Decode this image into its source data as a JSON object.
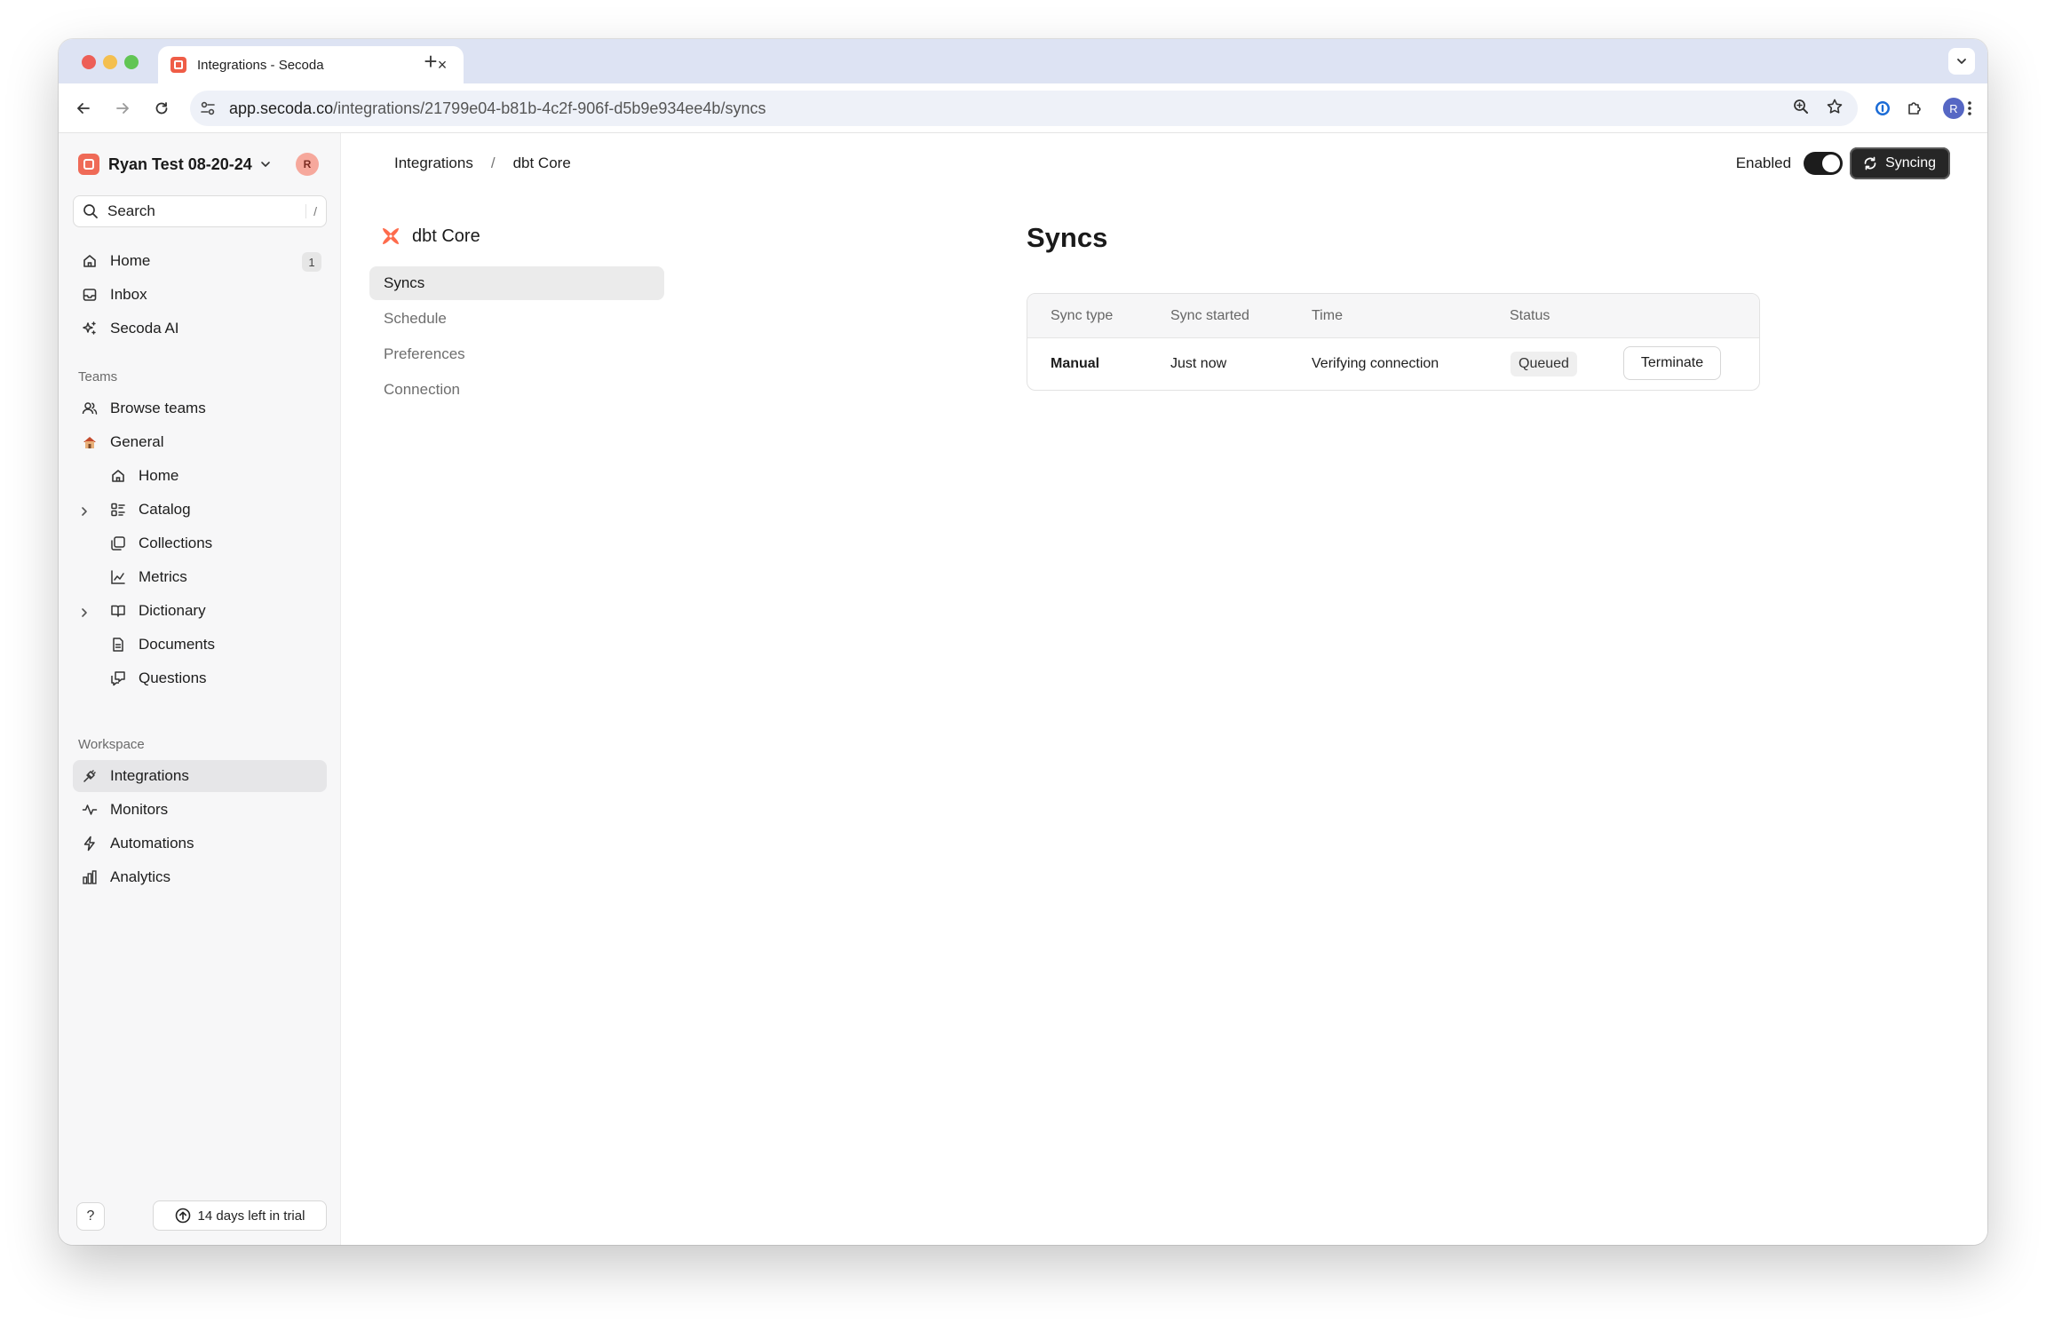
{
  "browser": {
    "tab_title": "Integrations - Secoda",
    "tab_close": "×",
    "new_tab": "+",
    "url_host": "app.secoda.co",
    "url_path": "/integrations/21799e04-b81b-4c2f-906f-d5b9e934ee4b/syncs",
    "profile_initial": "R"
  },
  "sidebar": {
    "workspace_name": "Ryan Test 08-20-24",
    "user_initial": "R",
    "search_label": "Search",
    "search_shortcut": "/",
    "top_items": [
      {
        "label": "Home",
        "icon": "home-icon",
        "count": "1"
      },
      {
        "label": "Inbox",
        "icon": "inbox-icon"
      },
      {
        "label": "Secoda AI",
        "icon": "sparkle-icon"
      }
    ],
    "teams_label": "Teams",
    "browse_teams": "Browse teams",
    "team_name": "General",
    "team_items": [
      {
        "label": "Home",
        "icon": "home-icon"
      },
      {
        "label": "Catalog",
        "icon": "catalog-icon"
      },
      {
        "label": "Collections",
        "icon": "collections-icon"
      },
      {
        "label": "Metrics",
        "icon": "metrics-icon"
      },
      {
        "label": "Dictionary",
        "icon": "book-icon"
      },
      {
        "label": "Documents",
        "icon": "document-icon"
      },
      {
        "label": "Questions",
        "icon": "questions-icon"
      }
    ],
    "workspace_label": "Workspace",
    "workspace_items": [
      {
        "label": "Integrations",
        "icon": "plug-icon"
      },
      {
        "label": "Monitors",
        "icon": "pulse-icon"
      },
      {
        "label": "Automations",
        "icon": "bolt-icon"
      },
      {
        "label": "Analytics",
        "icon": "bar-chart-icon"
      }
    ],
    "help_label": "?",
    "trial_label": "14 days left in trial"
  },
  "main": {
    "breadcrumb": [
      "Integrations",
      "dbt Core"
    ],
    "breadcrumb_sep": "/",
    "enabled_label": "Enabled",
    "syncing_label": "Syncing",
    "integration_name": "dbt Core",
    "subnav": [
      "Syncs",
      "Schedule",
      "Preferences",
      "Connection"
    ],
    "page_title": "Syncs",
    "table": {
      "headers": [
        "Sync type",
        "Sync started",
        "Time",
        "Status"
      ],
      "rows": [
        {
          "sync_type": "Manual",
          "sync_started": "Just now",
          "time": "Verifying connection",
          "status": "Queued",
          "action": "Terminate"
        }
      ]
    }
  },
  "colors": {
    "tabstrip": "#dde3f3",
    "sidebar_bg": "#f7f7f8",
    "brand": "#ef5d47",
    "dark_button": "#262626"
  }
}
